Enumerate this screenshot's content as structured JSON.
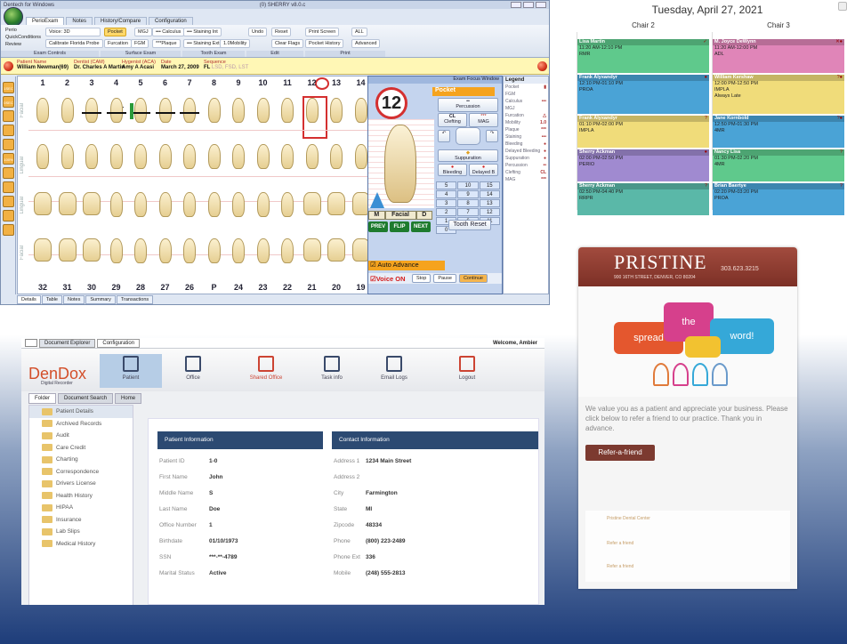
{
  "perio": {
    "window_title": "Dentech for Windows",
    "window_user": "(0) SHERRY  v8.0.c",
    "tabs": [
      "PerioExam",
      "Notes",
      "History/Compare",
      "Configuration"
    ],
    "ribbon": {
      "modes": [
        "Perio",
        "QuickConditions",
        "Review"
      ],
      "voice_label": "Voice: 3D",
      "calibrate": "Calibrate Florida Probe",
      "pocket": "Pocket",
      "mgj": "MGJ",
      "calculus": "••• Calculus",
      "staining_int": "••• Staining Int",
      "furcation": "Furcation",
      "fgm": "FGM",
      "plaque": "***Plaque",
      "staining_ext": "••• Staining Ext",
      "mobility": "1.0Mobility",
      "undo": "Undo",
      "reset": "Reset",
      "clear_flags": "Clear Flags",
      "print_screen": "Print Screen",
      "all": "ALL",
      "pocket_history": "Pocket History",
      "advanced": "Advanced",
      "groups": [
        "Exam Controls",
        "Surface Exam",
        "Tooth Exam",
        "Edit",
        "Print"
      ]
    },
    "patient_bar": {
      "labels": [
        "Patient Name",
        "Dentist (CAM)",
        "Hygenist (ACA)",
        "Date",
        "Sequence"
      ],
      "values": [
        "William   Newman(69)",
        "Dr. Charles A Martin",
        "Amy A Acasi",
        "March 27, 2009",
        "FL"
      ],
      "sequence_extra": "LSD, FSD, LST"
    },
    "side_buttons": [
      "1SEC",
      "0SEC",
      "",
      "",
      "",
      "100%",
      "",
      "",
      "",
      "",
      ""
    ],
    "section_labels": [
      "Facial",
      "Lingual",
      "Lingual",
      "Facial"
    ],
    "top_numbers": [
      "1",
      "2",
      "3",
      "4",
      "5",
      "6",
      "7",
      "8",
      "9",
      "10",
      "11",
      "12",
      "13",
      "14"
    ],
    "bottom_numbers": [
      "32",
      "31",
      "30",
      "29",
      "28",
      "27",
      "26",
      "P",
      "24",
      "23",
      "22",
      "21",
      "20",
      "19"
    ],
    "selected_tooth": "12",
    "markings": {
      "cl": "C.L.",
      "cl2": "C L"
    },
    "bottom_tabs": [
      "Details",
      "Table",
      "Notes",
      "Summary",
      "Transactions"
    ],
    "focus": {
      "title": "Exam Focus Window",
      "tooth_number": "12",
      "mode": "Pocket",
      "percussion": "Percussion",
      "percussion_sym": "••",
      "clefting": "Clefting",
      "clefting_sym": "CL",
      "mag": "MAG",
      "mag_sym": "***",
      "suppuration": "Suppuration",
      "bleeding": "Bleeding",
      "delayed": "Delayed B",
      "grid": [
        [
          "5",
          "10",
          "15"
        ],
        [
          "4",
          "9",
          "14"
        ],
        [
          "3",
          "8",
          "13"
        ],
        [
          "2",
          "7",
          "12"
        ],
        [
          "1",
          "6",
          "11"
        ],
        [
          "0",
          "",
          ""
        ]
      ],
      "surfaces": [
        "M",
        "Facial",
        "D"
      ],
      "prev": "PREV",
      "flip": "FLIP",
      "next": "NEXT",
      "tooth_reset": "Tooth Reset",
      "auto_advance": "Auto Advance",
      "voice_on": "Voice ON",
      "stop": "Stop",
      "pause": "Pause",
      "continue": "Continue"
    },
    "legend": {
      "title": "Legend",
      "rows": [
        [
          "Pocket",
          "▮"
        ],
        [
          "FGM",
          ""
        ],
        [
          "Calculus",
          "•••"
        ],
        [
          "MGJ",
          ""
        ],
        [
          "Furcation",
          "△"
        ],
        [
          "Mobility",
          "1.0"
        ],
        [
          "Plaque",
          "***"
        ],
        [
          "Staining",
          "•••"
        ],
        [
          "Bleeding",
          "●"
        ],
        [
          "Delayed Bleeding",
          "●"
        ],
        [
          "Suppuration",
          "●"
        ],
        [
          "Percussion",
          "••"
        ],
        [
          "Clefting",
          "CL"
        ],
        [
          "MAG",
          "***"
        ]
      ]
    }
  },
  "calendar": {
    "date": "Tuesday, April 27, 2021",
    "chair_a": "Chair 2",
    "chair_b": "Chair 3",
    "col_a": [
      {
        "name": "Lisa Martin",
        "time": "11:20 AM-12:10 PM",
        "code": "RMR",
        "flag": "✓"
      },
      {
        "name": "Frank Alyxandyr",
        "time": "12:10 PM-01:10 PM",
        "code": "PROA",
        "flag": "●"
      },
      {
        "name": "Frank Alyxandyr",
        "time": "01:10 PM-02:00 PM",
        "code": "IMPLA",
        "flag": "?"
      },
      {
        "name": "Sherry Ackman",
        "time": "02:00 PM-02:50 PM",
        "code": "PERIO",
        "flag": "●"
      },
      {
        "name": "Sherry Ackman",
        "time": "02:50 PM-04:40 PM",
        "code": "RRPR",
        "flag": "?"
      }
    ],
    "col_b": [
      {
        "name": "M. Joyce DeWynn",
        "time": "11:20 AM-12:00 PM",
        "code": "ADL",
        "flag": "✕●"
      },
      {
        "name": "William Kershaw",
        "time": "12:00 PM-12:50 PM",
        "code": "IMPLA",
        "code2": "Always Late",
        "flag": "?●"
      },
      {
        "name": "Jane Kornbold",
        "time": "12:50 PM-01:30 PM",
        "code": "4MR",
        "flag": "?●"
      },
      {
        "name": "Nancy Lisa",
        "time": "01:30 PM-02:20 PM",
        "code": "4MR",
        "flag": "?"
      },
      {
        "name": "Brian Baertye",
        "time": "02:20 PM-03:20 PM",
        "code": "PROA",
        "flag": "?"
      }
    ]
  },
  "pristine": {
    "logo": "PRISTINE",
    "phone": "303.623.3215",
    "address": "900 16TH STREET, DENVER, CO 80204",
    "bubbles": [
      "spread",
      "the",
      "word!"
    ],
    "message": "We value you as a patient and appreciate your business.  Please click below to refer a friend to our practice.  Thank you in advance.",
    "button": "Refer-a-friend",
    "footer": [
      "Pristine Dental Center",
      "Refer a friend",
      "Refer a friend"
    ]
  },
  "dendox": {
    "tabs": [
      "Document Explorer",
      "Configuration"
    ],
    "welcome": "Welcome, Ambier",
    "logo": "DenDox",
    "logo_sub": "Digital Recorder",
    "nav": [
      "Patient",
      "Office",
      "Shared Office",
      "Task info",
      "Email Logs",
      "Logout"
    ],
    "subtabs": [
      "Folder",
      "Document Search",
      "Home"
    ],
    "folders": [
      "Patient Details",
      "Archived Records",
      "Audit",
      "Care Credit",
      "Charting",
      "Correspondence",
      "Drivers License",
      "Health History",
      "HIPAA",
      "Insurance",
      "Lab Slips",
      "Medical History"
    ],
    "patient_header": "Patient Information",
    "contact_header": "Contact Information",
    "patient_rows": [
      [
        "Patient ID",
        "1-0"
      ],
      [
        "First Name",
        "John"
      ],
      [
        "Middle Name",
        "S"
      ],
      [
        "Last Name",
        "Doe"
      ],
      [
        "Office Number",
        "1"
      ],
      [
        "Birthdate",
        "01/10/1973"
      ],
      [
        "SSN",
        "***-**-4789"
      ],
      [
        "Marital Status",
        "Active"
      ]
    ],
    "contact_rows": [
      [
        "Address 1",
        "1234 Main Street"
      ],
      [
        "Address 2",
        ""
      ],
      [
        "City",
        "Farmington"
      ],
      [
        "State",
        "MI"
      ],
      [
        "Zipcode",
        "48334"
      ],
      [
        "Phone",
        "(800) 223-2489"
      ],
      [
        "Phone Ext",
        "336"
      ],
      [
        "Mobile",
        "(248) 555-2813"
      ]
    ]
  }
}
